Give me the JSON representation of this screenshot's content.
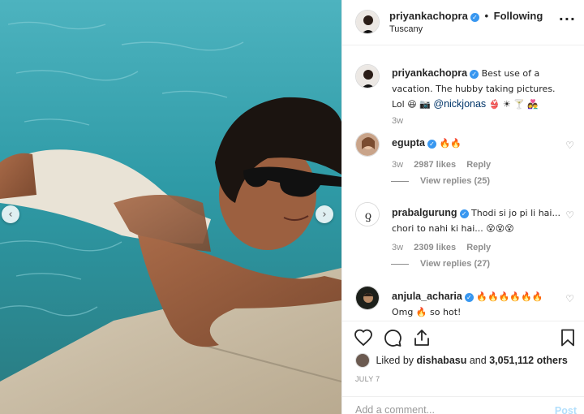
{
  "post": {
    "username": "priyankachopra",
    "follow_status": "Following",
    "dot": "•",
    "location": "Tuscany",
    "more_icon": "more-options-icon"
  },
  "caption": {
    "username": "priyankachopra",
    "text_before": "Best use of a vacation. The hubby taking pictures. Lol 😆 📷",
    "mention": "@nickjonas",
    "text_after": "👙 ☀ 🍸 👩‍❤️‍👨",
    "time": "3w"
  },
  "comments": [
    {
      "username": "egupta",
      "text": "🔥🔥",
      "time": "3w",
      "likes": "2987 likes",
      "reply": "Reply",
      "view_replies": "View replies (25)"
    },
    {
      "username": "prabalgurung",
      "text": "Thodi si jo pi li hai... chori to nahi ki hai... 😵😵😵",
      "time": "3w",
      "likes": "2309 likes",
      "reply": "Reply",
      "view_replies": "View replies (27)"
    },
    {
      "username": "anjula_acharia",
      "text": "🔥🔥🔥🔥🔥🔥",
      "body": "Omg 🔥 so hot!"
    }
  ],
  "likes": {
    "prefix": "Liked by",
    "user": "dishabasu",
    "and": "and",
    "count": "3,051,112 others"
  },
  "date": "JULY 7",
  "add_comment": {
    "placeholder": "Add a comment...",
    "post_label": "Post"
  },
  "colors": {
    "accent": "#3897f0",
    "text": "#262626",
    "muted": "#8e8e8e",
    "post_disabled": "#b2dffc"
  }
}
